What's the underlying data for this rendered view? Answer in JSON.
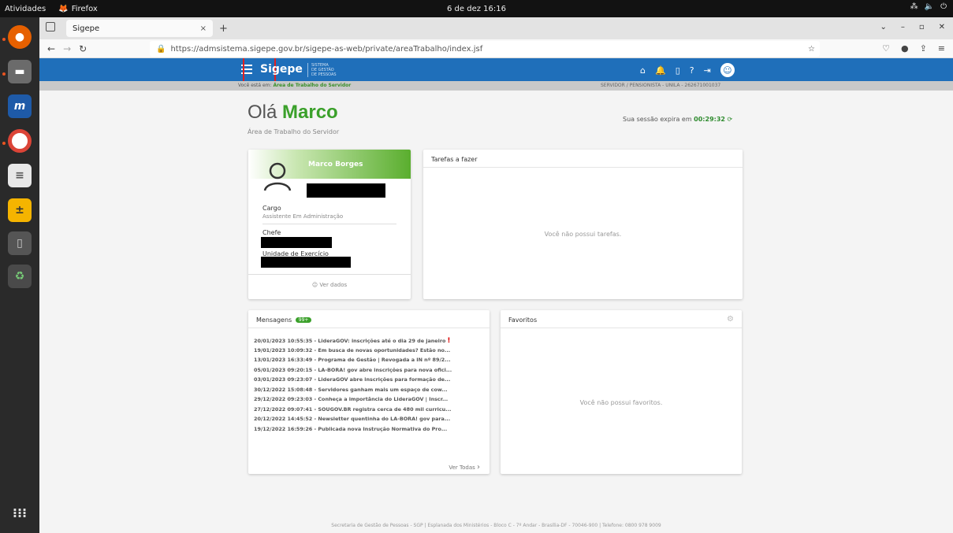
{
  "topbar": {
    "activities": "Atividades",
    "app_name": "Firefox",
    "clock": "6 de dez 16:16",
    "tray": [
      "network-icon",
      "volume-icon",
      "power-icon"
    ]
  },
  "dock": {
    "items": [
      "firefox-icon",
      "files-icon",
      "m-app-icon",
      "chrome-icon",
      "document-viewer-icon",
      "calculator-icon",
      "storage-icon",
      "trash-icon",
      "app-grid-icon"
    ]
  },
  "browser": {
    "tab_title": "Sigepe",
    "tab_close": "×",
    "new_tab": "+",
    "url": "https://admsistema.sigepe.gov.br/sigepe-as-web/private/areaTrabalho/index.jsf"
  },
  "app": {
    "logo": "Sigepe",
    "logo_sub_1": "SISTEMA",
    "logo_sub_2": "DE GESTÃO",
    "logo_sub_3": "DE PESSOAS",
    "breadcrumb_prefix": "Você está em:",
    "breadcrumb_current": "Área de Trabalho do Servidor",
    "servidor_info": "SERVIDOR / PENSIONISTA - UNILA - 262671001037",
    "greeting_prefix": "Olá",
    "greeting_name": "Marco",
    "greeting_sub": "Área de Trabalho do Servidor",
    "session_prefix": "Sua sessão expira em",
    "session_time": "00:29:32",
    "footer": "Secretaria de Gestão de Pessoas - SGP | Esplanada dos Ministérios - Bloco C - 7º Andar - Brasília-DF - 70046-900 | Telefone: 0800 978 9009"
  },
  "profile": {
    "name": "Marco Borges",
    "cargo_label": "Cargo",
    "cargo_value": "Assistente Em Administração",
    "chefe_label": "Chefe",
    "unidade_label": "Unidade de Exercício",
    "ver_dados": "Ver dados"
  },
  "tarefas": {
    "title": "Tarefas a fazer",
    "empty": "Você não possui tarefas."
  },
  "mensagens": {
    "title": "Mensagens",
    "badge": "99+",
    "items": [
      "20/01/2023 10:55:35 - LideraGOV: inscrições até o dia 29 de janeiro",
      "19/01/2023 10:09:32 - Em busca de novas oportunidades? Estão no...",
      "13/01/2023 16:33:49 - Programa de Gestão | Revogada a IN nº 89/2...",
      "05/01/2023 09:20:15 - LA-BORA! gov abre inscrições para nova ofici...",
      "03/01/2023 09:23:07 - LideraGOV abre inscrições para formação de...",
      "30/12/2022 15:08:48 - Servidores ganham mais um espaço de cow...",
      "29/12/2022 09:23:03 - Conheça a importância do LideraGOV | Inscr...",
      "27/12/2022 09:07:41 - SOUGOV.BR registra cerca de 480 mil curricu...",
      "20/12/2022 14:45:52 - Newsletter quentinha do LA-BORA! gov para...",
      "19/12/2022 16:59:26 - Publicada nova Instrução Normativa do Pro..."
    ],
    "first_exclamation": "!",
    "ver_todas": "Ver Todas"
  },
  "favoritos": {
    "title": "Favoritos",
    "empty": "Você não possui favoritos."
  }
}
